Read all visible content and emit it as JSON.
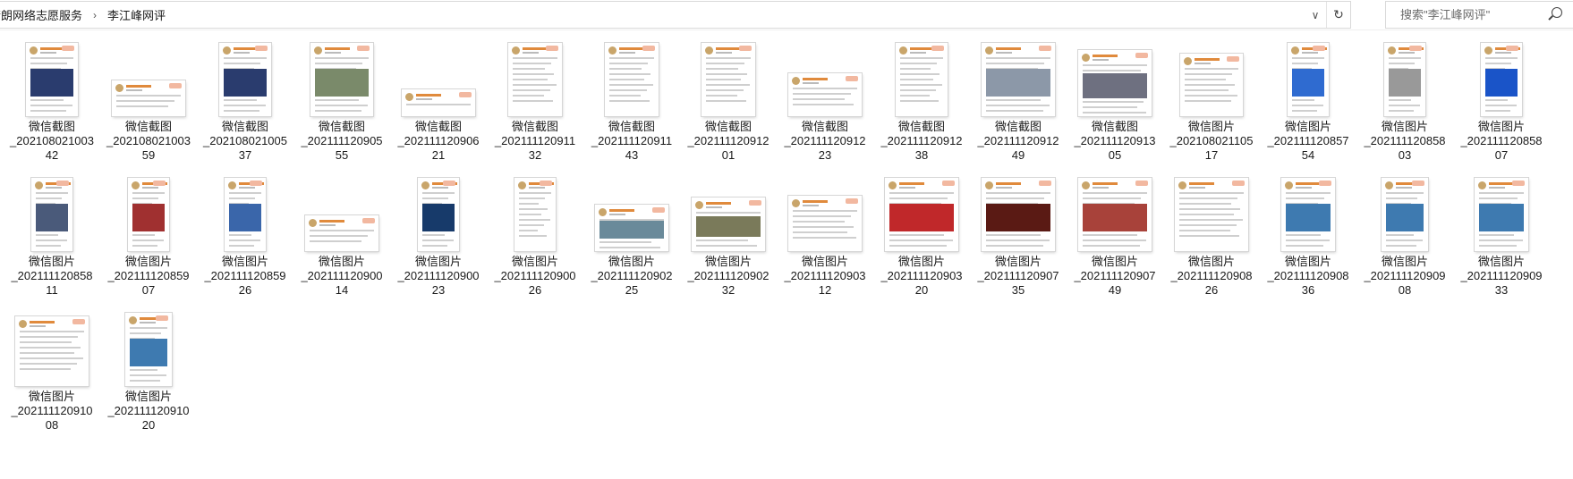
{
  "breadcrumb": [
    "晴朗网络志愿服务",
    "李江峰网评"
  ],
  "search": {
    "placeholder": "搜索\"李江峰网评\""
  },
  "files": [
    {
      "name_line1": "微信截图",
      "name_line2": "_202108021003",
      "name_line3": "42",
      "thumb_w": 58,
      "thumb_h": 82,
      "img_color": "#2a3c6e"
    },
    {
      "name_line1": "微信截图",
      "name_line2": "_202108021003",
      "name_line3": "59",
      "thumb_w": 82,
      "thumb_h": 40,
      "img_color": ""
    },
    {
      "name_line1": "微信截图",
      "name_line2": "_202108021005",
      "name_line3": "37",
      "thumb_w": 58,
      "thumb_h": 82,
      "img_color": "#2a3c6e"
    },
    {
      "name_line1": "微信截图",
      "name_line2": "_202111120905",
      "name_line3": "55",
      "thumb_w": 70,
      "thumb_h": 82,
      "img_color": "#7a8a6a"
    },
    {
      "name_line1": "微信截图",
      "name_line2": "_202111120906",
      "name_line3": "21",
      "thumb_w": 82,
      "thumb_h": 30,
      "img_color": ""
    },
    {
      "name_line1": "微信截图",
      "name_line2": "_202111120911",
      "name_line3": "32",
      "thumb_w": 60,
      "thumb_h": 82,
      "img_color": ""
    },
    {
      "name_line1": "微信截图",
      "name_line2": "_202111120911",
      "name_line3": "43",
      "thumb_w": 60,
      "thumb_h": 82,
      "img_color": ""
    },
    {
      "name_line1": "微信截图",
      "name_line2": "_202111120912",
      "name_line3": "01",
      "thumb_w": 60,
      "thumb_h": 82,
      "img_color": ""
    },
    {
      "name_line1": "微信截图",
      "name_line2": "_202111120912",
      "name_line3": "23",
      "thumb_w": 82,
      "thumb_h": 48,
      "img_color": ""
    },
    {
      "name_line1": "微信截图",
      "name_line2": "_202111120912",
      "name_line3": "38",
      "thumb_w": 58,
      "thumb_h": 82,
      "img_color": ""
    },
    {
      "name_line1": "微信截图",
      "name_line2": "_202111120912",
      "name_line3": "49",
      "thumb_w": 82,
      "thumb_h": 82,
      "img_color": "#8c98a8"
    },
    {
      "name_line1": "微信截图",
      "name_line2": "_202111120913",
      "name_line3": "05",
      "thumb_w": 82,
      "thumb_h": 74,
      "img_color": "#6e7080"
    },
    {
      "name_line1": "微信图片",
      "name_line2": "_202108021105",
      "name_line3": "17",
      "thumb_w": 70,
      "thumb_h": 70,
      "img_color": ""
    },
    {
      "name_line1": "微信图片",
      "name_line2": "_202111120857",
      "name_line3": "54",
      "thumb_w": 46,
      "thumb_h": 82,
      "img_color": "#2f6bd0"
    },
    {
      "name_line1": "微信图片",
      "name_line2": "_202111120858",
      "name_line3": "03",
      "thumb_w": 46,
      "thumb_h": 82,
      "img_color": "#999999"
    },
    {
      "name_line1": "微信图片",
      "name_line2": "_202111120858",
      "name_line3": "07",
      "thumb_w": 46,
      "thumb_h": 82,
      "img_color": "#1a54c8"
    },
    {
      "name_line1": "微信图片",
      "name_line2": "_202111120858",
      "name_line3": "11",
      "thumb_w": 46,
      "thumb_h": 82,
      "img_color": "#4a5a7a"
    },
    {
      "name_line1": "微信图片",
      "name_line2": "_202111120859",
      "name_line3": "07",
      "thumb_w": 46,
      "thumb_h": 82,
      "img_color": "#a03030"
    },
    {
      "name_line1": "微信图片",
      "name_line2": "_202111120859",
      "name_line3": "26",
      "thumb_w": 46,
      "thumb_h": 82,
      "img_color": "#3a66aa"
    },
    {
      "name_line1": "微信图片",
      "name_line2": "_202111120900",
      "name_line3": "14",
      "thumb_w": 82,
      "thumb_h": 40,
      "img_color": ""
    },
    {
      "name_line1": "微信图片",
      "name_line2": "_202111120900",
      "name_line3": "23",
      "thumb_w": 46,
      "thumb_h": 82,
      "img_color": "#173a6a"
    },
    {
      "name_line1": "微信图片",
      "name_line2": "_202111120900",
      "name_line3": "26",
      "thumb_w": 46,
      "thumb_h": 82,
      "img_color": ""
    },
    {
      "name_line1": "微信图片",
      "name_line2": "_202111120902",
      "name_line3": "25",
      "thumb_w": 82,
      "thumb_h": 52,
      "img_color": "#6a8a9a"
    },
    {
      "name_line1": "微信图片",
      "name_line2": "_202111120902",
      "name_line3": "32",
      "thumb_w": 82,
      "thumb_h": 60,
      "img_color": "#7a7a5a"
    },
    {
      "name_line1": "微信图片",
      "name_line2": "_202111120903",
      "name_line3": "12",
      "thumb_w": 82,
      "thumb_h": 62,
      "img_color": ""
    },
    {
      "name_line1": "微信图片",
      "name_line2": "_202111120903",
      "name_line3": "20",
      "thumb_w": 82,
      "thumb_h": 82,
      "img_color": "#c0282a"
    },
    {
      "name_line1": "微信图片",
      "name_line2": "_202111120907",
      "name_line3": "35",
      "thumb_w": 82,
      "thumb_h": 82,
      "img_color": "#5a1a14"
    },
    {
      "name_line1": "微信图片",
      "name_line2": "_202111120907",
      "name_line3": "49",
      "thumb_w": 82,
      "thumb_h": 82,
      "img_color": "#a8423a"
    },
    {
      "name_line1": "微信图片",
      "name_line2": "_202111120908",
      "name_line3": "26",
      "thumb_w": 82,
      "thumb_h": 82,
      "img_color": ""
    },
    {
      "name_line1": "微信图片",
      "name_line2": "_202111120908",
      "name_line3": "36",
      "thumb_w": 60,
      "thumb_h": 82,
      "img_color": "#3e7ab0"
    },
    {
      "name_line1": "微信图片",
      "name_line2": "_202111120909",
      "name_line3": "08",
      "thumb_w": 52,
      "thumb_h": 82,
      "img_color": "#3e7ab0"
    },
    {
      "name_line1": "微信图片",
      "name_line2": "_202111120909",
      "name_line3": "33",
      "thumb_w": 60,
      "thumb_h": 82,
      "img_color": "#3e7ab0"
    },
    {
      "name_line1": "微信图片",
      "name_line2": "_202111120910",
      "name_line3": "08",
      "thumb_w": 82,
      "thumb_h": 78,
      "img_color": ""
    },
    {
      "name_line1": "微信图片",
      "name_line2": "_202111120910",
      "name_line3": "20",
      "thumb_w": 52,
      "thumb_h": 82,
      "img_color": "#3e7ab0"
    }
  ]
}
